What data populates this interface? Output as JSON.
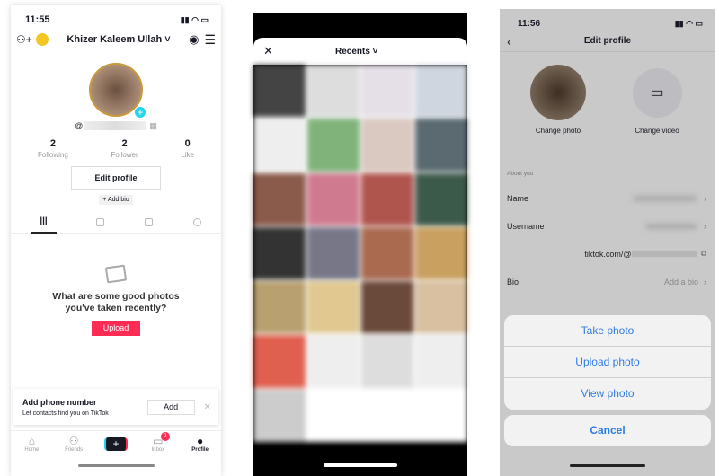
{
  "profile_screen": {
    "time": "11:55",
    "username": "Khizer Kaleem Ullah",
    "handle_prefix": "@",
    "stats": [
      {
        "value": "2",
        "label": "Following"
      },
      {
        "value": "2",
        "label": "Follower"
      },
      {
        "value": "0",
        "label": "Like"
      }
    ],
    "edit_profile": "Edit profile",
    "add_bio": "+ Add bio",
    "empty_title": "What are some good photos you've taken recently?",
    "upload": "Upload",
    "phone_card": {
      "title": "Add phone number",
      "subtitle": "Let contacts find you on TikTok",
      "button": "Add"
    },
    "nav": [
      {
        "label": "Home"
      },
      {
        "label": "Friends"
      },
      {
        "label": ""
      },
      {
        "label": "Inbox",
        "badge": "2"
      },
      {
        "label": "Profile"
      }
    ],
    "accent": "#fe2c55"
  },
  "picker_screen": {
    "title": "Recents"
  },
  "edit_screen": {
    "time": "11:56",
    "title": "Edit profile",
    "change_photo": "Change photo",
    "change_video": "Change video",
    "section": "About you",
    "name_label": "Name",
    "username_label": "Username",
    "link_prefix": "tiktok.com/@",
    "bio_label": "Bio",
    "bio_value": "Add a bio",
    "sheet": [
      "Take photo",
      "Upload photo",
      "View photo"
    ],
    "cancel": "Cancel",
    "action_color": "#2f7be6"
  }
}
